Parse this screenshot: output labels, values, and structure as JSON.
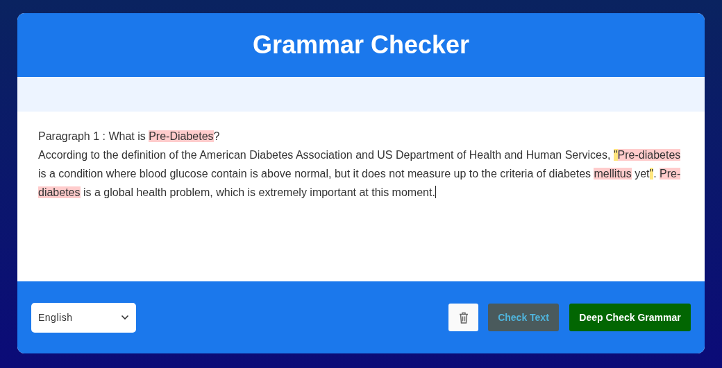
{
  "header": {
    "title": "Grammar Checker"
  },
  "editor": {
    "paragraphs": [
      {
        "segments": [
          {
            "text": "Paragraph 1 : What is ",
            "kind": "plain"
          },
          {
            "text": "Pre-Diabetes",
            "kind": "error"
          },
          {
            "text": "?",
            "kind": "plain"
          }
        ]
      },
      {
        "segments": [
          {
            "text": "According to the definition of the American Diabetes Association and US Department of Health and Human Services, ",
            "kind": "plain"
          },
          {
            "text": "\"",
            "kind": "warning"
          },
          {
            "text": "Pre-diabetes",
            "kind": "error"
          },
          {
            "text": " is a condition where blood glucose contain is above normal, but it does not measure up to the criteria of diabetes ",
            "kind": "plain"
          },
          {
            "text": "mellitus",
            "kind": "error"
          },
          {
            "text": " yet",
            "kind": "plain"
          },
          {
            "text": "\"",
            "kind": "warning"
          },
          {
            "text": ". ",
            "kind": "plain"
          },
          {
            "text": "Pre-diabetes",
            "kind": "error"
          },
          {
            "text": " is a global health problem, which is extremely important at this moment.",
            "kind": "plain"
          }
        ]
      }
    ]
  },
  "footer": {
    "language": {
      "value": "English"
    },
    "buttons": [
      {
        "kind": "icon"
      },
      {
        "kind": "secondary",
        "label": "Check Text"
      },
      {
        "kind": "primary",
        "label": "Deep Check Grammar"
      }
    ]
  }
}
